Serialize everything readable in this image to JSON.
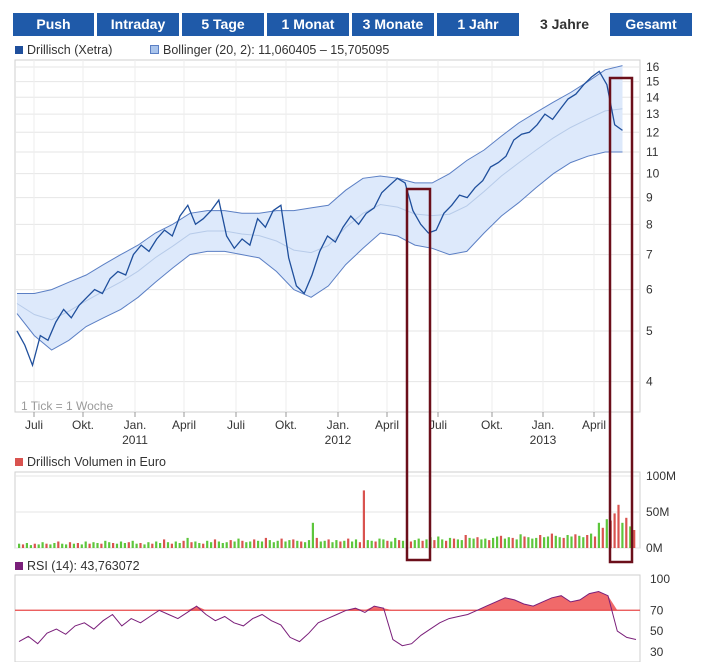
{
  "tabs": [
    {
      "label": "Push",
      "active": false
    },
    {
      "label": "Intraday",
      "active": false
    },
    {
      "label": "5 Tage",
      "active": false
    },
    {
      "label": "1 Monat",
      "active": false
    },
    {
      "label": "3 Monate",
      "active": false
    },
    {
      "label": "1 Jahr",
      "active": false
    },
    {
      "label": "3 Jahre",
      "active": true
    },
    {
      "label": "Gesamt",
      "active": false
    }
  ],
  "legends": {
    "price_series": "Drillisch (Xetra)",
    "bollinger": "Bollinger (20, 2): 11,060405 – 15,705095",
    "volume": "Drillisch Volumen in Euro",
    "rsi": "RSI (14): 43,763072"
  },
  "tick_note": "1 Tick = 1 Woche",
  "colors": {
    "tab_bg": "#1f5aa9",
    "price_line": "#1f4f9c",
    "band_fill": "#dde9fb",
    "band_line": "#5b7fc4",
    "volume_up": "#5dc63c",
    "volume_down": "#d9534f",
    "rsi_line": "#7a1f7a",
    "rsi_threshold": "#e84a4a",
    "highlight_box": "#6b0f1a"
  },
  "chart_data": [
    {
      "type": "line",
      "title": "Drillisch (Xetra)",
      "x_tick_labels": [
        "Juli",
        "Okt.",
        "Jan.",
        "April",
        "Juli",
        "Okt.",
        "Jan.",
        "April",
        "Juli",
        "Okt.",
        "Jan.",
        "April"
      ],
      "year_labels": [
        "2011",
        "2012",
        "2013"
      ],
      "y_scale": "log",
      "ylim": [
        3.5,
        16.5
      ],
      "y_ticks": [
        4,
        5,
        6,
        7,
        8,
        9,
        10,
        11,
        12,
        13,
        14,
        15,
        16
      ],
      "grid": true,
      "legend_position": "top-left",
      "series": [
        {
          "name": "Drillisch (Xetra)",
          "x_weeks": [
            0,
            2,
            4,
            6,
            8,
            10,
            12,
            14,
            16,
            18,
            20,
            22,
            24,
            26,
            28,
            30,
            32,
            34,
            36,
            38,
            40,
            42,
            44,
            46,
            48,
            50,
            52,
            54,
            56,
            58,
            60,
            62,
            64,
            66,
            68,
            70,
            72,
            74,
            76,
            78,
            80,
            82,
            84,
            86,
            88,
            90,
            92,
            94,
            96,
            98,
            100,
            102,
            104,
            106,
            108,
            110,
            112,
            114,
            116,
            118,
            120,
            122,
            124,
            126,
            128,
            130,
            132,
            134,
            136,
            138,
            140,
            142,
            144,
            146,
            148,
            150,
            152,
            154,
            156
          ],
          "values": [
            5.0,
            4.7,
            4.3,
            4.9,
            4.8,
            5.2,
            5.5,
            5.3,
            5.6,
            5.8,
            6.0,
            5.9,
            6.3,
            6.5,
            6.4,
            7.0,
            7.3,
            7.1,
            7.5,
            7.8,
            7.6,
            8.3,
            8.7,
            8.0,
            8.2,
            8.5,
            8.9,
            7.6,
            7.2,
            7.5,
            7.3,
            8.2,
            7.9,
            8.5,
            8.7,
            6.9,
            6.1,
            5.9,
            6.4,
            7.1,
            7.6,
            7.4,
            7.9,
            8.3,
            8.0,
            8.4,
            8.6,
            9.2,
            9.5,
            9.8,
            9.6,
            8.5,
            8.0,
            7.7,
            7.8,
            8.4,
            8.7,
            9.1,
            9.0,
            9.4,
            9.7,
            10.3,
            10.5,
            10.8,
            11.6,
            11.9,
            12.0,
            12.4,
            13.0,
            12.7,
            13.3,
            13.9,
            14.2,
            14.8,
            15.3,
            15.7,
            14.8,
            12.4,
            12.1
          ]
        },
        {
          "name": "Bollinger (20, 2)",
          "upper": [
            5.9,
            5.9,
            6.0,
            6.2,
            6.4,
            6.7,
            7.0,
            7.3,
            7.7,
            8.0,
            8.4,
            8.5,
            8.5,
            8.4,
            8.4,
            8.5,
            8.5,
            8.6,
            8.7,
            9.3,
            9.8,
            9.9,
            9.8,
            9.6,
            9.6,
            10.0,
            10.6,
            11.1,
            11.8,
            12.5,
            13.1,
            13.7,
            14.3,
            15.0,
            15.8,
            16.1
          ],
          "lower": [
            5.4,
            4.9,
            4.6,
            4.8,
            5.1,
            5.3,
            5.5,
            5.8,
            6.2,
            6.6,
            7.0,
            7.1,
            7.1,
            7.0,
            6.9,
            6.5,
            6.0,
            5.8,
            6.1,
            6.7,
            7.2,
            7.7,
            7.6,
            7.3,
            7.2,
            7.0,
            7.1,
            7.7,
            8.3,
            8.8,
            9.4,
            10.0,
            10.5,
            10.8,
            11.0,
            11.0
          ]
        }
      ],
      "annotations": [
        "highlight box around the April–Juli 2012 drop",
        "highlight box around the April 2013 peak"
      ]
    },
    {
      "type": "bar",
      "title": "Drillisch Volumen in Euro",
      "unit": "Euro",
      "y_tick_labels": [
        "0M",
        "50M",
        "100M"
      ],
      "ylim": [
        0,
        100
      ],
      "y_unit_scale": "millions",
      "legend_position": "top-left",
      "values_millions": [
        6,
        5,
        7,
        4,
        6,
        5,
        8,
        6,
        5,
        7,
        9,
        6,
        5,
        8,
        6,
        7,
        5,
        9,
        6,
        8,
        7,
        6,
        10,
        8,
        7,
        6,
        9,
        7,
        8,
        10,
        6,
        7,
        5,
        8,
        6,
        9,
        7,
        12,
        8,
        6,
        9,
        7,
        10,
        14,
        8,
        9,
        7,
        6,
        10,
        8,
        12,
        9,
        7,
        8,
        11,
        9,
        13,
        10,
        8,
        9,
        12,
        10,
        9,
        14,
        11,
        8,
        10,
        13,
        9,
        11,
        12,
        10,
        9,
        8,
        11,
        35,
        14,
        9,
        10,
        12,
        8,
        11,
        9,
        10,
        13,
        9,
        12,
        8,
        80,
        11,
        10,
        9,
        13,
        12,
        10,
        9,
        14,
        11,
        10,
        12,
        9,
        11,
        13,
        10,
        12,
        15,
        11,
        16,
        12,
        10,
        14,
        13,
        12,
        11,
        18,
        14,
        13,
        15,
        12,
        13,
        11,
        14,
        16,
        17,
        13,
        15,
        14,
        12,
        19,
        16,
        15,
        13,
        14,
        18,
        15,
        16,
        20,
        17,
        15,
        14,
        18,
        16,
        19,
        17,
        15,
        18,
        20,
        16,
        35,
        28,
        40,
        38,
        48,
        60,
        35,
        42,
        30,
        25
      ],
      "up_flags": [
        1,
        0,
        1,
        1,
        0,
        1,
        1,
        0,
        1,
        1,
        0,
        1,
        1,
        0,
        1,
        0,
        1,
        1,
        0,
        1,
        1,
        0,
        1,
        1,
        0,
        1,
        1,
        1,
        0,
        1,
        1,
        0,
        1,
        1,
        0,
        1,
        1,
        0,
        1,
        0,
        1,
        1,
        0,
        1,
        0,
        1,
        1,
        0,
        1,
        1,
        0,
        1,
        1,
        1,
        0,
        1,
        1,
        0,
        1,
        1,
        0,
        1,
        1,
        0,
        1,
        1,
        1,
        0,
        1,
        1,
        0,
        1,
        0,
        1,
        1,
        1,
        0,
        1,
        1,
        0,
        1,
        1,
        0,
        1,
        0,
        1,
        1,
        0,
        0,
        1,
        1,
        0,
        1,
        1,
        0,
        1,
        1,
        0,
        1,
        1,
        0,
        1,
        1,
        0,
        1,
        1,
        0,
        1,
        1,
        0,
        1,
        0,
        1,
        1,
        0,
        1,
        1,
        0,
        1,
        1,
        0,
        1,
        1,
        0,
        1,
        1,
        0,
        1,
        1,
        0,
        1,
        1,
        1,
        0,
        1,
        1,
        0,
        1,
        1,
        0,
        1,
        1,
        0,
        1,
        1,
        0,
        1,
        0,
        1,
        0,
        1,
        0,
        0,
        0,
        1,
        0,
        1,
        0
      ]
    },
    {
      "type": "line",
      "title": "RSI (14)",
      "y_ticks": [
        30,
        50,
        70,
        100
      ],
      "ylim": [
        30,
        100
      ],
      "threshold": 70,
      "legend_position": "top-left",
      "values": [
        40,
        45,
        38,
        48,
        52,
        47,
        55,
        58,
        52,
        60,
        66,
        55,
        62,
        58,
        64,
        70,
        66,
        62,
        68,
        74,
        66,
        60,
        64,
        58,
        55,
        62,
        66,
        60,
        56,
        44,
        40,
        48,
        58,
        62,
        66,
        70,
        72,
        68,
        74,
        72,
        42,
        36,
        38,
        46,
        52,
        58,
        62,
        64,
        66,
        70,
        74,
        78,
        82,
        80,
        76,
        74,
        78,
        82,
        84,
        78,
        80,
        86,
        88,
        84,
        50,
        44,
        42
      ]
    }
  ]
}
